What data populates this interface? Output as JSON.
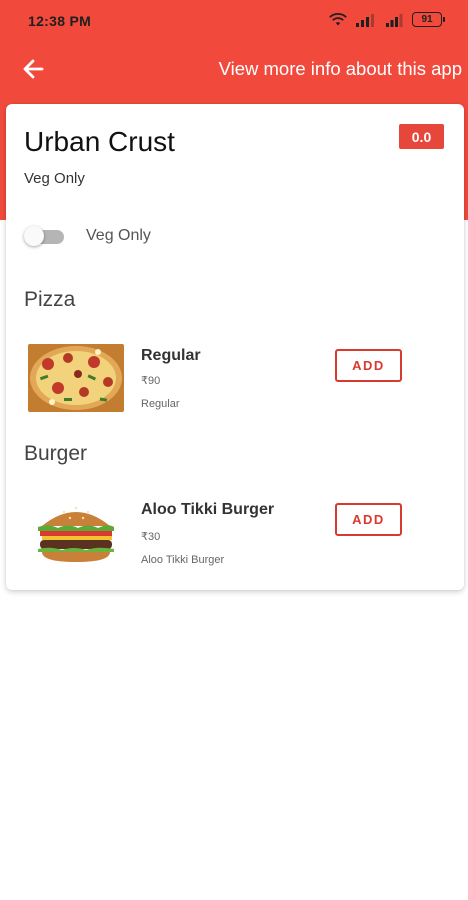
{
  "status_bar": {
    "time": "12:38 PM",
    "battery": "91"
  },
  "app_bar": {
    "info_link": "View more info about this app"
  },
  "restaurant": {
    "name": "Urban Crust",
    "tag": "Veg Only",
    "rating": "0.0"
  },
  "filter": {
    "veg_only_label": "Veg Only",
    "veg_only_enabled": false
  },
  "sections": [
    {
      "title": "Pizza",
      "items": [
        {
          "name": "Regular",
          "price": "₹90",
          "description": "Regular",
          "add_label": "ADD",
          "image": "pizza-image"
        }
      ]
    },
    {
      "title": "Burger",
      "items": [
        {
          "name": "Aloo Tikki Burger",
          "price": "₹30",
          "description": "Aloo Tikki Burger",
          "add_label": "ADD",
          "image": "burger-image"
        }
      ]
    }
  ],
  "colors": {
    "header": "#f14a3d",
    "accent": "#d93a2f",
    "badge": "#e7463a"
  },
  "icons": {
    "back": "arrow-left-icon",
    "wifi": "wifi-icon",
    "signal": "signal-icon",
    "battery": "battery-icon"
  }
}
